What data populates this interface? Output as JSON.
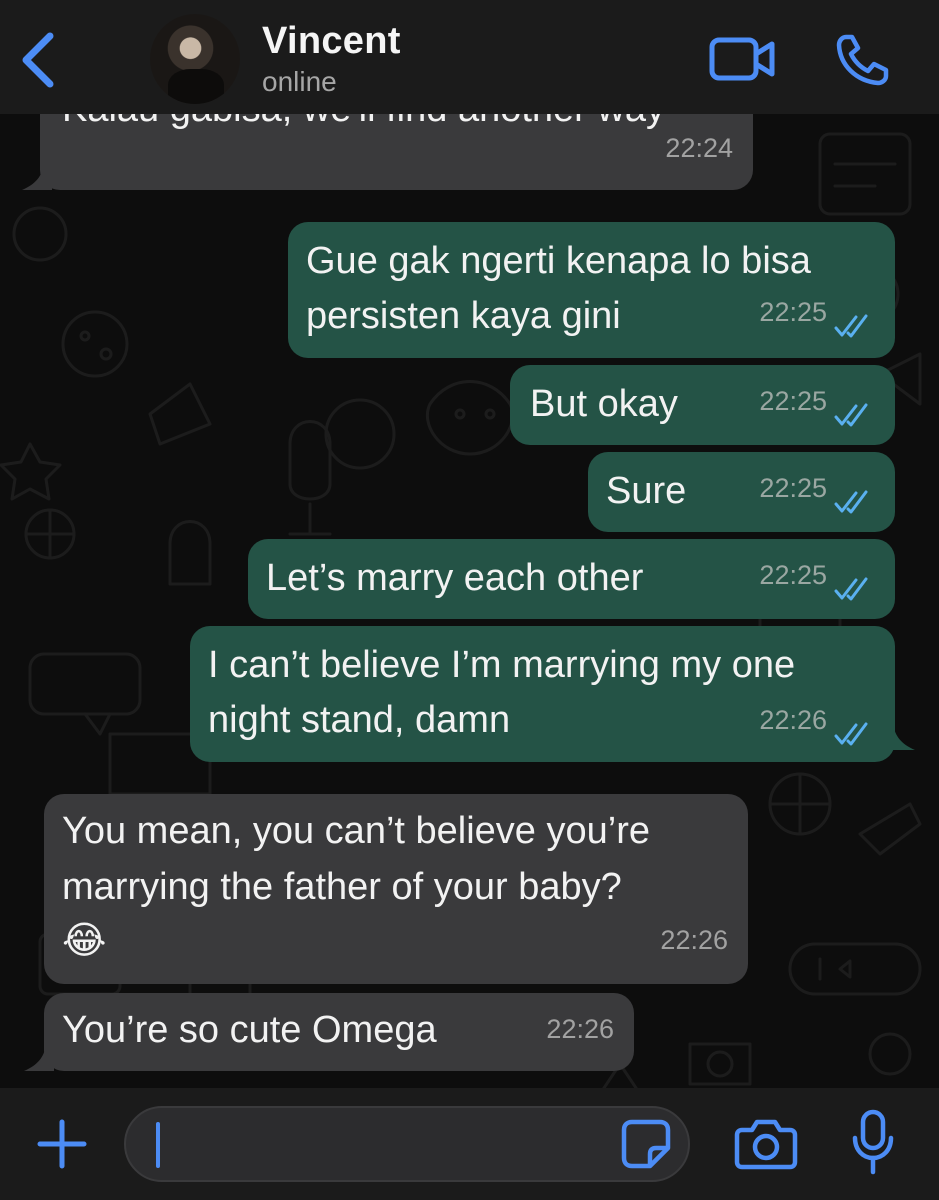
{
  "header": {
    "contact_name": "Vincent",
    "status": "online"
  },
  "colors": {
    "accent": "#4c8cf5",
    "incoming_bubble": "#3a3a3c",
    "outgoing_bubble": "#245346",
    "read_ticks": "#5ab0f0",
    "background": "#0d0d0d"
  },
  "icons": [
    "back-chevron-icon",
    "video-camera-icon",
    "phone-icon",
    "plus-icon",
    "sticker-icon",
    "camera-icon",
    "microphone-icon",
    "double-check-icon"
  ],
  "messages": [
    {
      "dir": "in",
      "lines": [
        "Kalau gabisa, we'll find another way"
      ],
      "time": "22:24"
    },
    {
      "dir": "out",
      "lines": [
        "Gue gak ngerti kenapa lo bisa",
        "persisten kaya gini"
      ],
      "time": "22:25",
      "read": true
    },
    {
      "dir": "out",
      "lines": [
        "But okay"
      ],
      "time": "22:25",
      "read": true
    },
    {
      "dir": "out",
      "lines": [
        "Sure"
      ],
      "time": "22:25",
      "read": true
    },
    {
      "dir": "out",
      "lines": [
        "Let’s marry each other"
      ],
      "time": "22:25",
      "read": true
    },
    {
      "dir": "out",
      "lines": [
        "I can’t believe I’m marrying my one",
        "night stand, damn"
      ],
      "time": "22:26",
      "read": true
    },
    {
      "dir": "in",
      "lines": [
        "You mean, you can’t believe you’re",
        "marrying the father of your baby?",
        "😂"
      ],
      "time": "22:26"
    },
    {
      "dir": "in",
      "lines": [
        "You’re so cute Omega"
      ],
      "time": "22:26"
    }
  ],
  "composer": {
    "value": ""
  }
}
